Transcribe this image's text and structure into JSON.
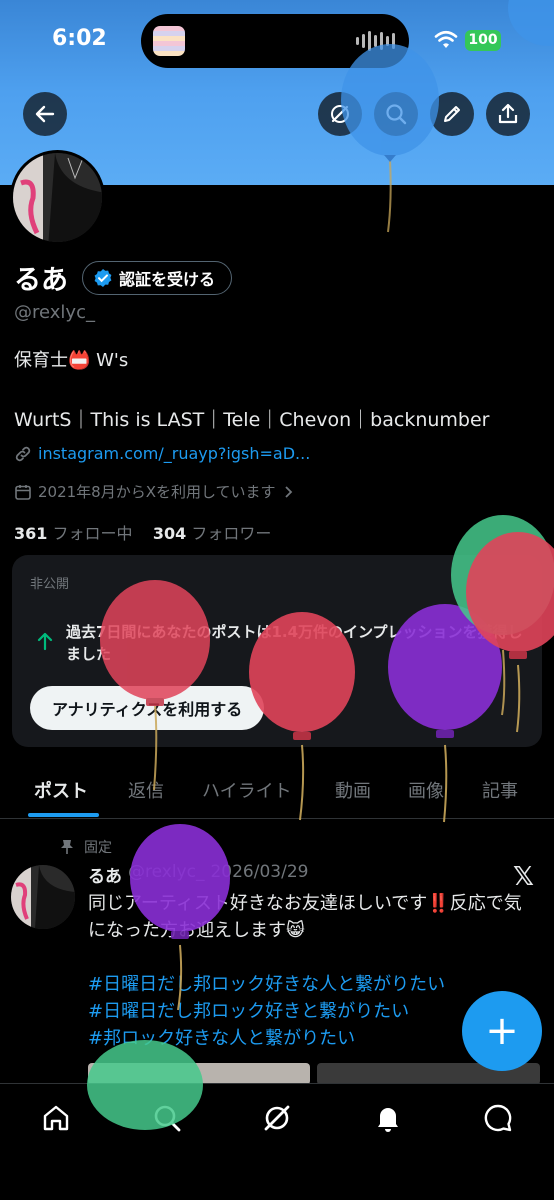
{
  "status_bar": {
    "time": "6:02",
    "battery": "100"
  },
  "profile": {
    "display_name": "るあ",
    "verify_button": "認証を受ける",
    "handle": "@rexlyc_",
    "bio": "保育士📛 W's",
    "interests": "WurtS｜This is LAST｜Tele｜Chevon｜backnumber",
    "link": "instagram.com/_ruayp?igsh=aD...",
    "joined": "2021年8月からXを利用しています",
    "following_count": "361",
    "following_label": "フォロー中",
    "followers_count": "304",
    "followers_label": "フォロワー"
  },
  "analytics_card": {
    "label": "非公開",
    "text": "過去7日間にあなたのポストは1.4万件のインプレッションを獲得しました",
    "button": "アナリティクスを利用する"
  },
  "tabs": [
    "ポスト",
    "返信",
    "ハイライト",
    "動画",
    "画像",
    "記事"
  ],
  "pinned_post": {
    "pinned_label": "固定",
    "author": "るあ",
    "handle": "@rexlyc_",
    "date": "2026/03/29",
    "body": "同じアーティスト好きなお友達ほしいです‼️反応で気になった方お迎えします😸",
    "hashtags": [
      "#日曜日だし邦ロック好きな人と繋がりたい",
      "#日曜日だし邦ロック好きと繋がりたい",
      "#邦ロック好きな人と繋がりたい"
    ]
  },
  "fab_label": "+",
  "colors": {
    "accent": "#1d9bf0",
    "banner": "#4ea0ef",
    "background": "#000000"
  },
  "icons": [
    "back-arrow-icon",
    "grok-icon",
    "search-icon",
    "edit-icon",
    "share-icon",
    "home-icon",
    "explore-icon",
    "grok-nav-icon",
    "notifications-icon",
    "messages-icon"
  ]
}
